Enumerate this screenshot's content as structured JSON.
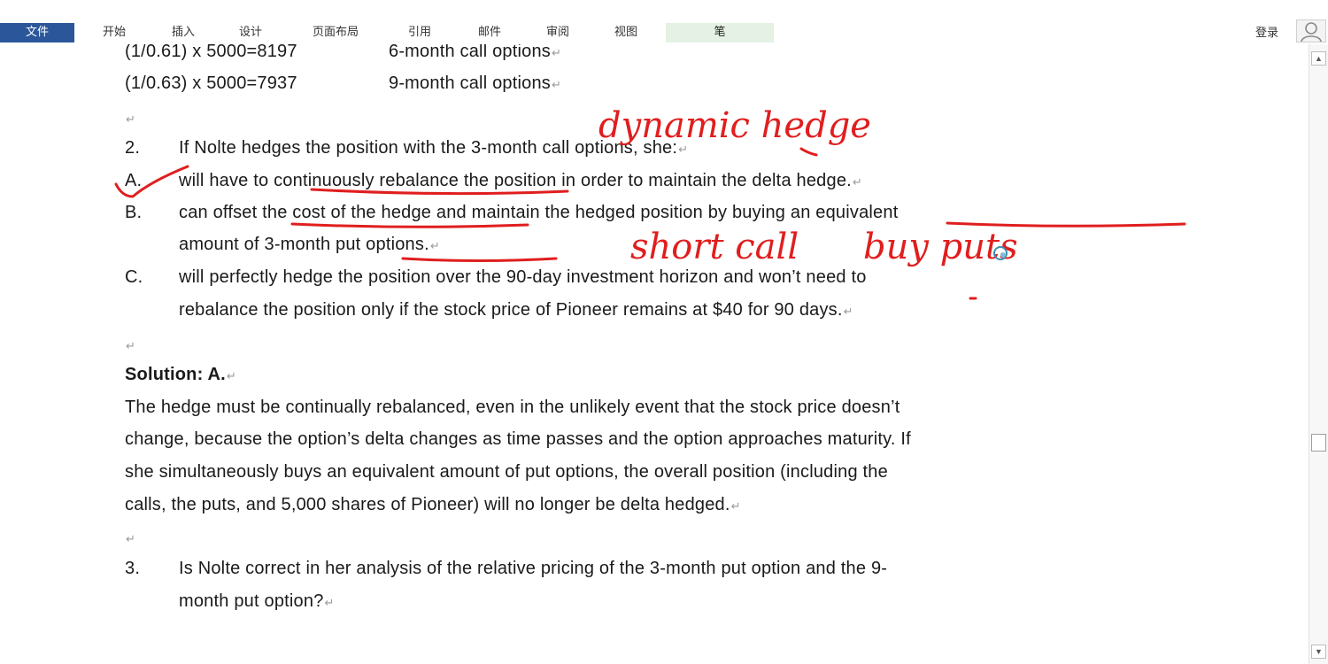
{
  "ribbon": {
    "tabs": [
      {
        "label": "文件",
        "active": true
      },
      {
        "label": "开始"
      },
      {
        "label": "插入"
      },
      {
        "label": "设计"
      },
      {
        "label": "页面布局"
      },
      {
        "label": "引用"
      },
      {
        "label": "邮件"
      },
      {
        "label": "审阅"
      },
      {
        "label": "视图"
      },
      {
        "label": "笔"
      }
    ],
    "login": "登录"
  },
  "doc": {
    "row1_calc": "(1/0.61) x 5000=8197",
    "row1_desc": "6-month call options",
    "row2_calc": "(1/0.63) x 5000=7937",
    "row2_desc": "9-month call options",
    "q2_num": "2.",
    "q2_text": "If Nolte hedges the position with the 3-month call options, she:",
    "optA_label": "A.",
    "optA_text": "will have to continuously rebalance the position in order to maintain the delta hedge.",
    "optB_label": "B.",
    "optB_text1": "can offset the cost of the hedge and maintain the hedged position by buying an equivalent",
    "optB_text2": "amount of 3-month put options.",
    "optC_label": "C.",
    "optC_text1": "will perfectly hedge the position over the 90-day investment horizon and won’t need to",
    "optC_text2": "rebalance the position only if the stock price of Pioneer remains at $40 for 90 days.",
    "solution": "Solution: A.",
    "sol1": "The hedge must be continually rebalanced, even in the unlikely event that the stock price doesn’t",
    "sol2": "change, because the option’s delta changes as time passes and the option approaches maturity. If",
    "sol3": "she simultaneously buys an equivalent amount of put options, the overall position (including the",
    "sol4": "calls, the puts, and 5,000 shares of Pioneer) will no longer be delta hedged.",
    "q3_num": "3.",
    "q3_text1": "Is Nolte correct in her analysis of the relative pricing of the 3-month put option and the 9-",
    "q3_text2": "month put option?",
    "para_mark": "↵"
  },
  "annotations": {
    "ink_color": "#e01e1e",
    "note1": "dynamic hedge",
    "note2": "short call",
    "note3": "buy puts"
  }
}
